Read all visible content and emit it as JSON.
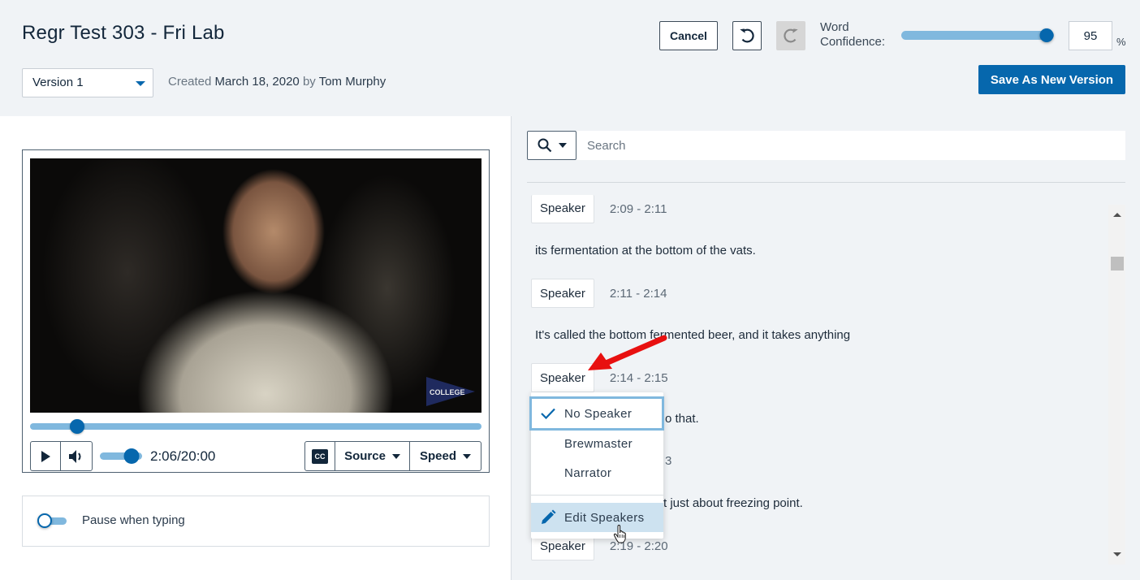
{
  "header": {
    "title": "Regr Test 303 - Fri Lab",
    "version_select": {
      "value": "Version 1"
    },
    "created": {
      "prefix": "Created",
      "date": "March 18, 2020",
      "by": "by",
      "author": "Tom Murphy"
    },
    "cancel_label": "Cancel",
    "undo_icon": "undo-icon",
    "redo_icon": "redo-icon",
    "word_confidence": {
      "label_line1": "Word",
      "label_line2": "Confidence:",
      "value": "95",
      "unit": "%",
      "slider_percent": 95
    },
    "save_label": "Save As New Version"
  },
  "player": {
    "watermark": "COLLEGE",
    "progress_fraction": 0.105,
    "time": "2:06/20:00",
    "volume_fraction": 0.75,
    "play_icon": "play-icon",
    "volume_icon": "volume-icon",
    "cc_label": "CC",
    "source_label": "Source",
    "speed_label": "Speed",
    "pause_when_typing": {
      "label": "Pause when typing",
      "on": false
    }
  },
  "search": {
    "placeholder": "Search",
    "value": ""
  },
  "transcript": {
    "segments": [
      {
        "speaker": "Speaker",
        "time": "2:09 - 2:11",
        "text": "its fermentation at the bottom of the vats."
      },
      {
        "speaker": "Speaker",
        "time": "2:11 - 2:14",
        "text": "It's called the bottom fermented beer, and it takes anything"
      },
      {
        "speaker": "Speaker",
        "time": "2:14 - 2:15",
        "text": "o that."
      },
      {
        "speaker": "",
        "time": "3",
        "text": "t just about freezing point."
      },
      {
        "speaker": "Speaker",
        "time": "2:19 - 2:20",
        "text": ""
      }
    ]
  },
  "speaker_dropdown": {
    "items": [
      {
        "label": "No Speaker",
        "selected": true
      },
      {
        "label": "Brewmaster",
        "selected": false
      },
      {
        "label": "Narrator",
        "selected": false
      }
    ],
    "edit_label": "Edit Speakers"
  },
  "colors": {
    "accent": "#0667ad",
    "accent_light": "#80b8de",
    "background": "#f0f3f6",
    "annotation_arrow": "#e81010"
  }
}
